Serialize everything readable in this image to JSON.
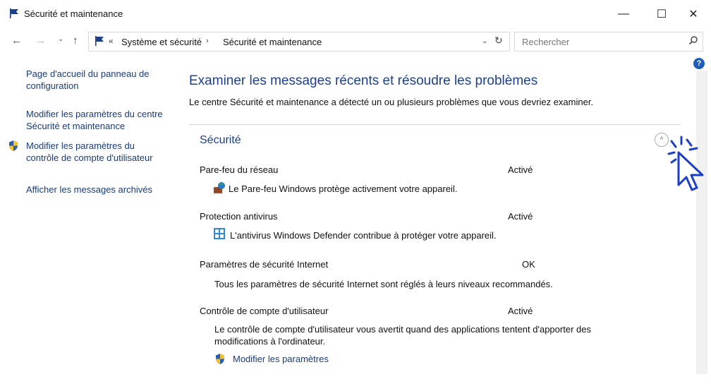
{
  "window": {
    "title": "Sécurité et maintenance",
    "minimize_label": "—",
    "maximize_label": "☐",
    "close_label": "✕"
  },
  "nav": {
    "back_label": "←",
    "forward_label": "→",
    "recent_label": "⌄",
    "up_label": "↑"
  },
  "address": {
    "overflow": "«",
    "crumbs": [
      "Système et sécurité",
      "Sécurité et maintenance"
    ],
    "separator": "›",
    "dropdown_label": "⌄",
    "refresh_label": "↻"
  },
  "search": {
    "placeholder": "Rechercher"
  },
  "help": {
    "label": "?"
  },
  "sidebar": {
    "items": [
      {
        "label": "Page d'accueil du panneau de configuration"
      },
      {
        "label": "Modifier les paramètres du centre Sécurité et maintenance"
      },
      {
        "label": "Modifier les paramètres du contrôle de compte d'utilisateur"
      },
      {
        "label": "Afficher les messages archivés"
      }
    ]
  },
  "main": {
    "title": "Examiner les messages récents et résoudre les problèmes",
    "description": "Le centre Sécurité et maintenance a détecté un ou plusieurs problèmes que vous devriez examiner.",
    "section": {
      "title": "Sécurité",
      "collapse_label": "^",
      "items": [
        {
          "label": "Pare-feu du réseau",
          "status": "Activé",
          "description": "Le Pare-feu Windows protège activement votre appareil."
        },
        {
          "label": "Protection antivirus",
          "status": "Activé",
          "description": "L'antivirus Windows Defender contribue à protéger votre appareil."
        },
        {
          "label": "Paramètres de sécurité Internet",
          "status": "OK",
          "description": "Tous les paramètres de sécurité Internet sont réglés à leurs niveaux recommandés."
        },
        {
          "label": "Contrôle de compte d'utilisateur",
          "status": "Activé",
          "description": "Le contrôle de compte d'utilisateur vous avertit quand des applications tentent d'apporter des modifications à l'ordinateur.",
          "link": "Modifier les paramètres"
        }
      ]
    }
  },
  "colors": {
    "heading_blue": "#1e3f8f",
    "link_blue": "#1a3a7a",
    "accent_blue": "#1d5fb8"
  }
}
